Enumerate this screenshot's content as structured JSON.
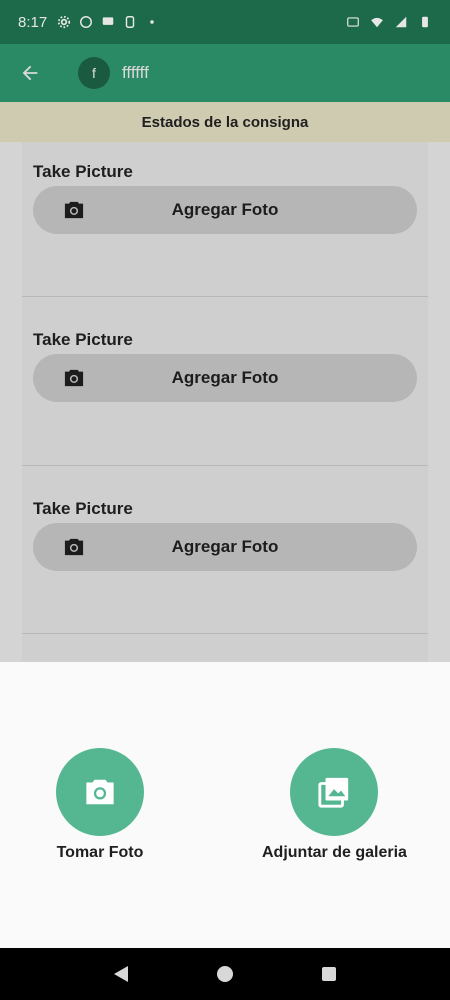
{
  "status_bar": {
    "time": "8:17"
  },
  "app_bar": {
    "avatar_letter": "f",
    "title": "ffffff"
  },
  "banner": {
    "text": "Estados de la consigna"
  },
  "sections": [
    {
      "label": "Take Picture",
      "button_label": "Agregar Foto"
    },
    {
      "label": "Take Picture",
      "button_label": "Agregar Foto"
    },
    {
      "label": "Take Picture",
      "button_label": "Agregar Foto"
    }
  ],
  "bottom_sheet": {
    "take_photo_label": "Tomar Foto",
    "gallery_label": "Adjuntar de galeria"
  },
  "colors": {
    "app_bar": "#2a8a66",
    "status_bar": "#1c6a49",
    "banner": "#cfcbb0",
    "accent": "#55b792"
  },
  "icons": [
    "back-arrow-icon",
    "camera-icon",
    "gallery-icon",
    "wifi-icon",
    "signal-icon",
    "battery-icon"
  ]
}
